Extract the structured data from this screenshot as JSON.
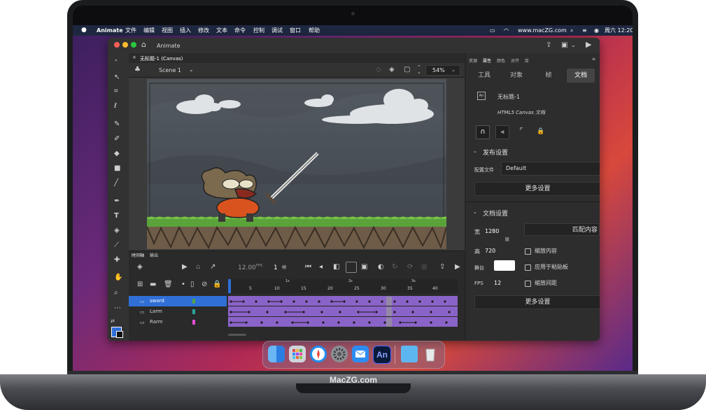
{
  "menubar": {
    "apple": "",
    "app_name": "Animate",
    "items": [
      "文件",
      "编辑",
      "视图",
      "插入",
      "修改",
      "文本",
      "命令",
      "控制",
      "调试",
      "窗口",
      "帮助"
    ],
    "website": "www.macZG.com",
    "clock": "周六 12:20"
  },
  "window": {
    "title": "Animate",
    "document_tab": "无标题-1 (Canvas)",
    "scene_label": "Scene 1",
    "zoom": "54%"
  },
  "panel_tabs": [
    "资源",
    "属性",
    "颜色",
    "对齐",
    "库"
  ],
  "props": {
    "tabs": [
      "工具",
      "对象",
      "帧",
      "文档"
    ],
    "doc_icon_label": "An",
    "doc_name": "无标题-1",
    "doc_type": "HTML5 Canvas 文档",
    "publish_section": "发布设置",
    "profile_label": "配置文件",
    "profile_value": "Default",
    "more_settings_1": "更多设置",
    "doc_section": "文档设置",
    "width_label": "宽",
    "width_value": "1280",
    "height_label": "高",
    "height_value": "720",
    "match_content": "匹配内容",
    "scale_content": "缩放内容",
    "apply_to_pasteboard": "应用于粘贴板",
    "stage_label": "舞台",
    "fps_label": "FPS",
    "fps_value": "12",
    "scale_spacing": "缩放间距",
    "more_settings_2": "更多设置"
  },
  "timeline": {
    "tabs": [
      "时间轴",
      "输出"
    ],
    "fps_display": "12.00",
    "fps_unit": "FPS",
    "current_frame": "1",
    "frame_unit": "帧",
    "seconds": [
      "1s",
      "2s",
      "3s"
    ],
    "frame_numbers": [
      "5",
      "10",
      "15",
      "20",
      "25",
      "30",
      "35",
      "40"
    ],
    "layers": [
      {
        "name": "sword",
        "color": "#55a14a"
      },
      {
        "name": "Larm",
        "color": "#2aa59c"
      },
      {
        "name": "Rarm",
        "color": "#e04fd0"
      }
    ]
  },
  "brand": "MacZG.com",
  "colors": {
    "accent_blue": "#2f6fd6",
    "frame_purple": "#8a63c8",
    "grass_green": "#5aa33a"
  }
}
